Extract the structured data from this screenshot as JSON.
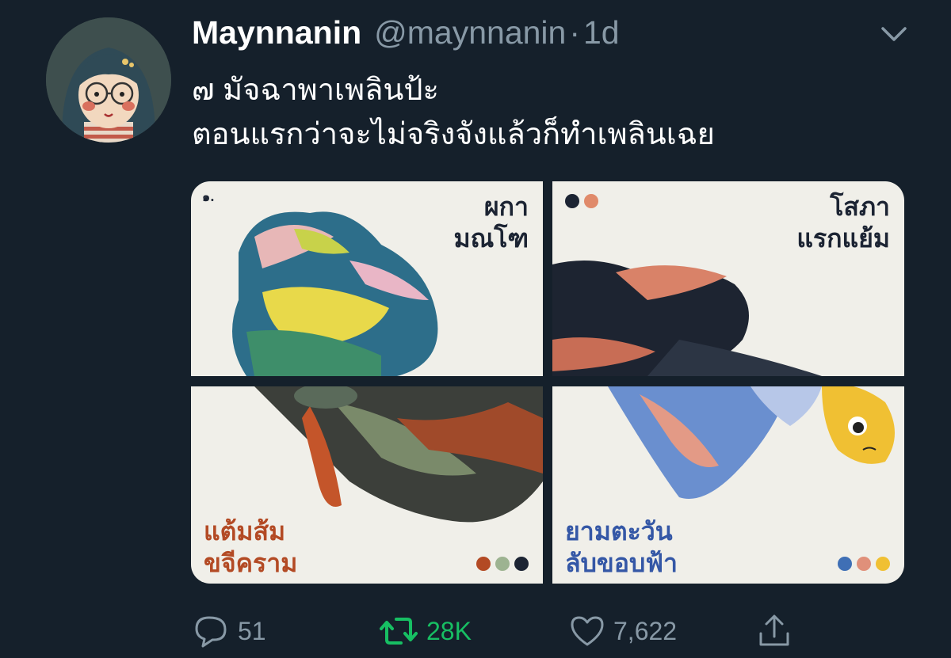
{
  "tweet": {
    "author_name": "Maynnanin",
    "handle": "@maynnanin",
    "separator": "·",
    "time": "1d",
    "text_lines": [
      "๗ มัจฉาพาเพลินป้ะ",
      "ตอนแรกว่าจะไม่จริงจังแล้วก็ทำเพลินเฉย"
    ]
  },
  "media": {
    "tiles": [
      {
        "number": "๑.",
        "label_lines": [
          "ผกา",
          "มณโฑ"
        ],
        "swatches": []
      },
      {
        "label_lines": [
          "โสภา",
          "แรกแย้ม"
        ],
        "swatches": [
          "#1c2433",
          "#e08a6a"
        ]
      },
      {
        "label_lines": [
          "แต้มส้ม",
          "ขจีคราม"
        ],
        "swatches": [
          "#b34a24",
          "#9db391",
          "#1c2433"
        ]
      },
      {
        "label_lines": [
          "ยามตะวัน",
          "ลับขอบฟ้า"
        ],
        "swatches": [
          "#3f6fb5",
          "#e0907a",
          "#f0c033"
        ]
      }
    ]
  },
  "actions": {
    "replies": "51",
    "retweets": "28K",
    "likes": "7,622"
  },
  "colors": {
    "background": "#15202b",
    "secondary_text": "#8899a6",
    "retweet_active": "#17bf63"
  },
  "icons": [
    "chevron-down-icon",
    "reply-icon",
    "retweet-icon",
    "like-icon",
    "share-icon"
  ]
}
